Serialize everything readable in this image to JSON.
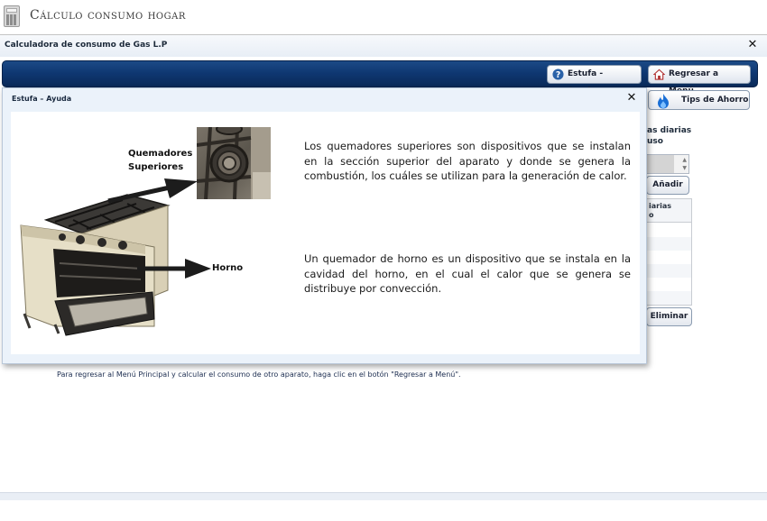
{
  "app": {
    "title": "Cálculo consumo hogar"
  },
  "window": {
    "title": "Calculadora de consumo de Gas L.P",
    "close_glyph": "✕"
  },
  "toolbar": {
    "help_label": "Estufa - Ayuda",
    "back_label": "Regresar a Menú"
  },
  "panel": {
    "tips_label": "Tips de Ahorro",
    "partial_label": "as diarias\nuso",
    "add_label": "Añadir",
    "grid_header": "iarias\no",
    "delete_label": "Eliminar"
  },
  "footnote": "Para regresar al Menú Principal y calcular el consumo de otro aparato, haga clic en el botón \"Regresar a Menú\".",
  "help_dialog": {
    "title": "Estufa – Ayuda",
    "close_glyph": "✕",
    "label_quemadores_1": "Quemadores",
    "label_quemadores_2": "Superiores",
    "label_horno": "Horno",
    "paragraph_1": "Los quemadores superiores son dispositivos que se instalan en la sección superior del aparato y donde se genera la combustión, los cuáles se utilizan para la generación de calor.",
    "paragraph_2": "Un quemador de horno es un dispositivo que se instala en la cavidad del horno, en el cual el calor que se genera se distribuye por convección."
  },
  "colors": {
    "toolbar": "#0e3670",
    "dialog_bg": "#ebf2fa",
    "accent_blue": "#1a6fd6"
  }
}
